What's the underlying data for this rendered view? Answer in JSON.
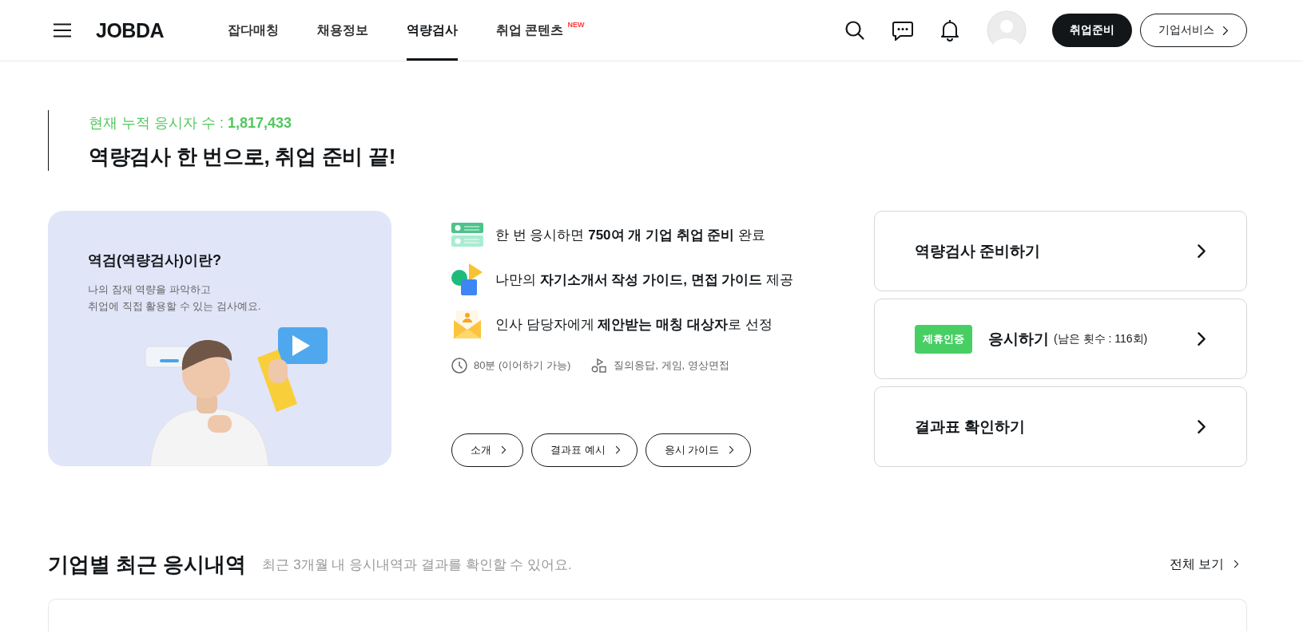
{
  "header": {
    "logo": "JOBDA",
    "nav": [
      {
        "label": "잡다매칭",
        "selected": false
      },
      {
        "label": "채용정보",
        "selected": false
      },
      {
        "label": "역량검사",
        "selected": true
      },
      {
        "label": "취업 콘텐츠",
        "selected": false,
        "badge": "NEW"
      }
    ],
    "buttons": [
      {
        "label": "취업준비",
        "kind": "primary"
      },
      {
        "label": "기업서비스",
        "kind": "outline"
      }
    ]
  },
  "intro": {
    "count": "현재 누적 응시자 수 : **1,817,433**",
    "title": "역량검사 한 번으로, 취업 준비 끝!"
  },
  "panel": {
    "title": "역검(역량검사)이란?",
    "description": "나의 잠재 역량을 파악하고\n취업에 직접 활용할 수 있는 검사예요."
  },
  "features": [
    {
      "kind": "cards",
      "text": "한 번 응시하면 **750여 개 기업 취업 준비** 완료"
    },
    {
      "kind": "shapes",
      "text": "나만의 **자기소개서 작성 가이드, 면접 가이드** 제공"
    },
    {
      "kind": "mail",
      "text": "인사 담당자에게 **제안받는 매칭 대상자**로 선정"
    }
  ],
  "meta": [
    {
      "kind": "clock",
      "text": "80분 (이어하기 가능)"
    },
    {
      "kind": "shapes",
      "text": "질의응답, 게임, 영상면접"
    }
  ],
  "links": [
    "소개",
    "결과표 예시",
    "응시 가이드"
  ],
  "actions": [
    {
      "title": "역량검사 준비하기"
    },
    {
      "badge": "제휴인증",
      "title": "응시하기",
      "note": "(남은 횟수 : 116회)"
    },
    {
      "title": "결과표 확인하기"
    }
  ],
  "history": {
    "title": "기업별 최근 응시내역",
    "subtitle": "최근 3개월 내 응시내역과 결과를 확인할 수 있어요.",
    "more": "전체 보기"
  }
}
